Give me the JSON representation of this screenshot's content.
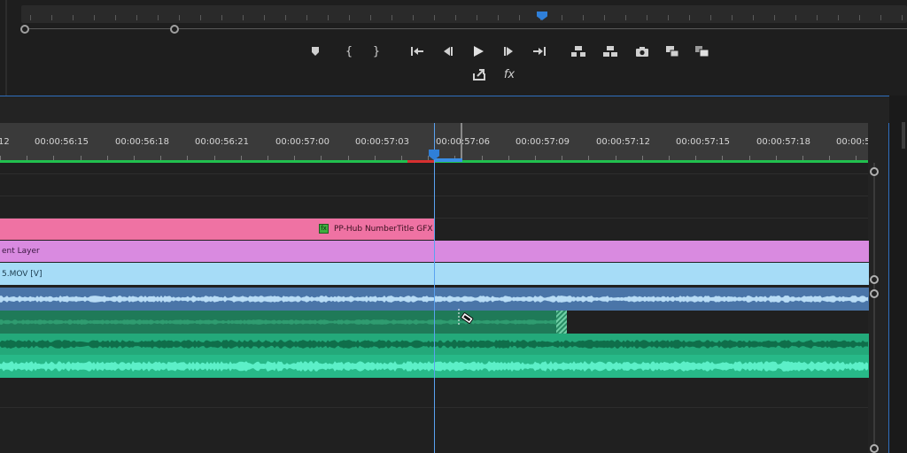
{
  "program_monitor": {
    "transport_buttons": [
      {
        "name": "add-marker-button",
        "icon": "marker-icon"
      },
      {
        "name": "mark-in-button",
        "icon": "mark-in-icon",
        "glyph": "{"
      },
      {
        "name": "mark-out-button",
        "icon": "mark-out-icon",
        "glyph": "}"
      },
      {
        "name": "go-to-in-button",
        "icon": "go-to-in-icon"
      },
      {
        "name": "step-back-button",
        "icon": "step-back-icon"
      },
      {
        "name": "play-button",
        "icon": "play-icon"
      },
      {
        "name": "step-forward-button",
        "icon": "step-forward-icon"
      },
      {
        "name": "go-to-out-button",
        "icon": "go-to-out-icon"
      },
      {
        "name": "lift-button",
        "icon": "lift-icon"
      },
      {
        "name": "extract-button",
        "icon": "extract-icon"
      },
      {
        "name": "export-frame-button",
        "icon": "camera-icon"
      },
      {
        "name": "compare-view-button",
        "icon": "compare-view-icon"
      },
      {
        "name": "multi-camera-button",
        "icon": "multi-camera-icon"
      }
    ],
    "secondary_buttons": [
      {
        "name": "export-button",
        "icon": "export-icon"
      },
      {
        "name": "fx-button",
        "icon": "fx-icon",
        "glyph": "fx"
      }
    ]
  },
  "timeline": {
    "timecodes": [
      "12",
      "00:00:56:15",
      "00:00:56:18",
      "00:00:56:21",
      "00:00:57:00",
      "00:00:57:03",
      "00:00:57:06",
      "00:00:57:09",
      "00:00:57:12",
      "00:00:57:15",
      "00:00:57:18",
      "00:00:5"
    ],
    "clips": {
      "gfx": {
        "label": "PP-Hub NumberTitle GFX",
        "badge": "fx",
        "color": "#ef72a3"
      },
      "adjustment": {
        "label": "ent Layer",
        "color": "#d98ae0"
      },
      "video": {
        "label": "5.MOV [V]",
        "color": "#a6dcf7"
      }
    },
    "colors": {
      "work_area": "#21c04e",
      "playhead": "#2f7fd8",
      "audio_blue": "#4a75a8",
      "audio_green": "#23a97a"
    },
    "cursor_icon": "razor-tool-icon"
  }
}
